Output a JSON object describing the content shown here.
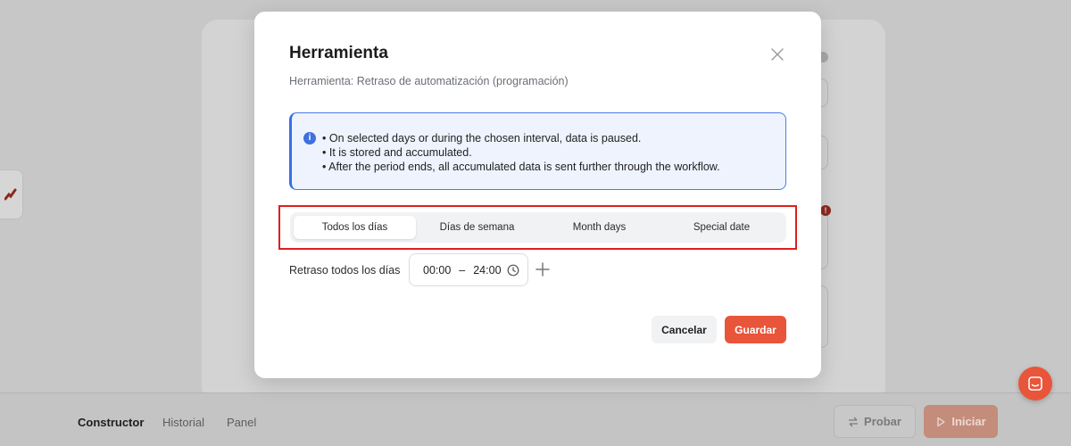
{
  "modal": {
    "title": "Herramienta",
    "subtitle": "Herramienta: Retraso de automatización (programación)",
    "info_lines": [
      "On selected days or during the chosen interval, data is paused.",
      "It is stored and accumulated.",
      "After the period ends, all accumulated data is sent further through the workflow."
    ],
    "tabs": [
      {
        "label": "Todos los días",
        "active": true
      },
      {
        "label": "Días de semana",
        "active": false
      },
      {
        "label": "Month days",
        "active": false
      },
      {
        "label": "Special date",
        "active": false
      }
    ],
    "delay_label": "Retraso todos los días",
    "time_start": "00:00",
    "time_separator": "–",
    "time_end": "24:00",
    "cancel_label": "Cancelar",
    "save_label": "Guardar"
  },
  "bottom_nav": {
    "items": [
      {
        "label": "Constructor",
        "active": true
      },
      {
        "label": "Historial",
        "active": false
      },
      {
        "label": "Panel",
        "active": false
      }
    ],
    "probar_label": "Probar",
    "iniciar_label": "Iniciar"
  },
  "background": {
    "warning_badge": "!"
  },
  "icons": {
    "close": "close-icon",
    "info": "info-icon",
    "clock": "clock-icon",
    "add": "plus-icon",
    "probar": "swap-arrows-icon",
    "iniciar": "play-icon",
    "chat": "chat-icon"
  },
  "colors": {
    "accent": "#e8553a",
    "info_border": "#4a7bea",
    "info_bg": "#eef3fe",
    "highlight": "#e01e1e"
  }
}
